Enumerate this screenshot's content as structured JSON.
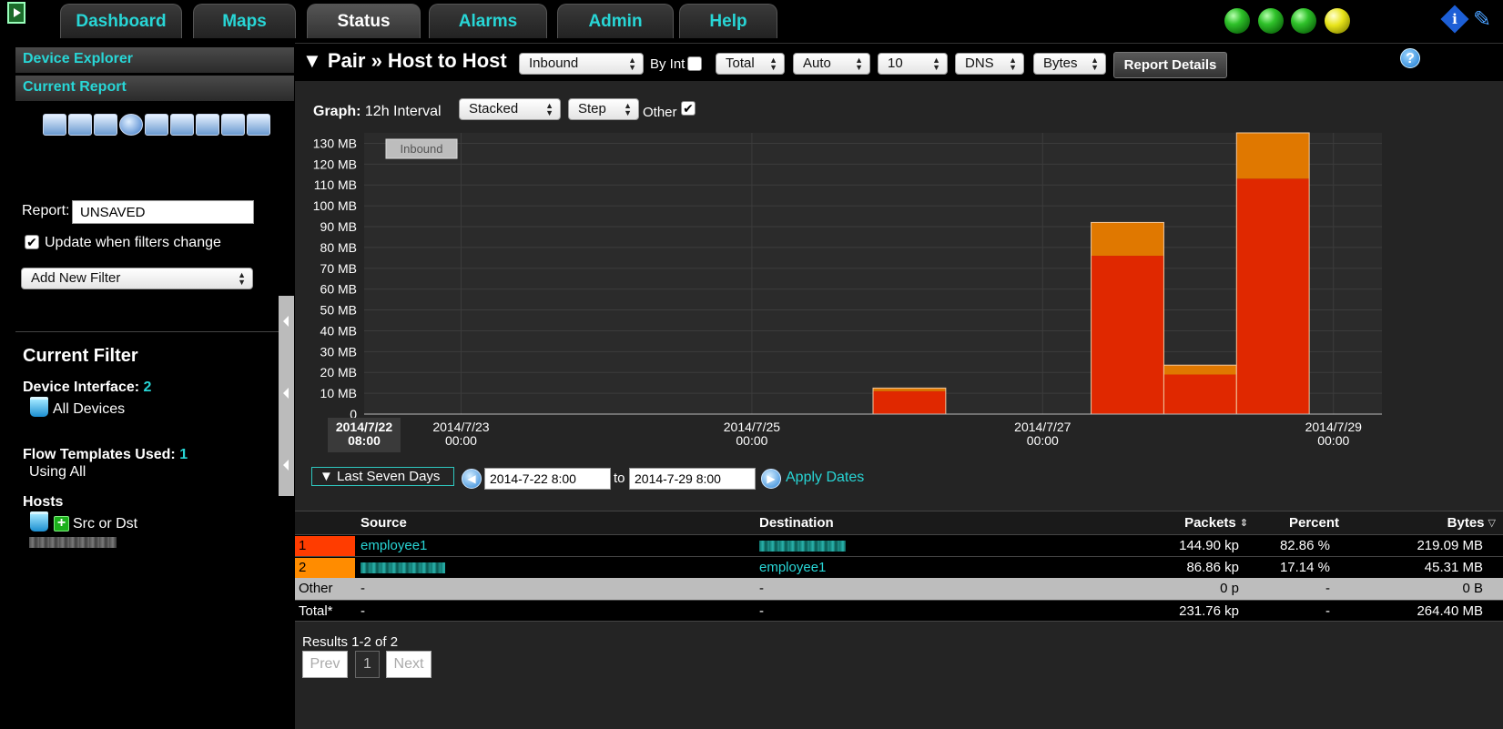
{
  "nav": {
    "tabs": [
      {
        "label": "Dashboard",
        "active": false
      },
      {
        "label": "Maps",
        "active": false
      },
      {
        "label": "Status",
        "active": true
      },
      {
        "label": "Alarms",
        "active": false
      },
      {
        "label": "Admin",
        "active": false
      },
      {
        "label": "Help",
        "active": false
      }
    ],
    "status_leds": [
      "green",
      "green",
      "green",
      "yellow"
    ],
    "icons": [
      "info-icon",
      "tools-icon"
    ]
  },
  "sidebar": {
    "device_explorer": "Device Explorer",
    "current_report": "Current Report",
    "toolbar_icons": [
      "edit-icon",
      "save-icon",
      "save-as-icon",
      "schedule-icon",
      "print-icon",
      "export-icon",
      "email-icon",
      "fax-icon",
      "pdf-icon"
    ],
    "report_label": "Report:",
    "report_value": "UNSAVED",
    "update_label": "Update when filters change",
    "update_checked": true,
    "add_filter": "Add New Filter",
    "current_filter_title": "Current Filter",
    "device_interface_label": "Device Interface:",
    "device_interface_count": "2",
    "all_devices": "All Devices",
    "flow_templates_label": "Flow Templates Used:",
    "flow_templates_count": "1",
    "using_all": "Using All",
    "hosts_label": "Hosts",
    "src_or_dst": "Src or Dst"
  },
  "report": {
    "title": "▼ Pair » Host to Host",
    "direction": "Inbound",
    "by_int_label": "By Int",
    "total": "Total",
    "auto": "Auto",
    "count": "10",
    "dns": "DNS",
    "unit": "Bytes",
    "report_details": "Report Details",
    "help": "?",
    "graph_label": "Graph:",
    "graph_interval": "12h Interval",
    "graph_mode": "Stacked",
    "graph_style": "Step",
    "other_label": "Other",
    "other_checked": true
  },
  "chart_data": {
    "type": "area",
    "stacked": true,
    "step": true,
    "legend_label": "Inbound",
    "y_ticks": [
      "0",
      "10 MB",
      "20 MB",
      "30 MB",
      "40 MB",
      "50 MB",
      "60 MB",
      "70 MB",
      "80 MB",
      "90 MB",
      "100 MB",
      "110 MB",
      "120 MB",
      "130 MB"
    ],
    "ylim": [
      0,
      135
    ],
    "x_tick_labels": [
      {
        "date": "2014/7/22",
        "time": "08:00",
        "highlight": true
      },
      {
        "date": "2014/7/23",
        "time": "00:00"
      },
      {
        "date": "2014/7/25",
        "time": "00:00"
      },
      {
        "date": "2014/7/27",
        "time": "00:00"
      },
      {
        "date": "2014/7/29",
        "time": "00:00"
      }
    ],
    "x_tick_hours": [
      0,
      16,
      64,
      112,
      160
    ],
    "interval_start_hours": [
      0,
      12,
      24,
      36,
      48,
      60,
      72,
      84,
      96,
      108,
      120,
      132,
      144,
      156
    ],
    "series": [
      {
        "name": "employee1",
        "color": "#e02800",
        "values": [
          0,
          0,
          0,
          0,
          0,
          0,
          0,
          11,
          0,
          0,
          76,
          19,
          113,
          0
        ]
      },
      {
        "name": "2",
        "color": "#e07800",
        "values": [
          0,
          0,
          0,
          0,
          0,
          0,
          0,
          1.5,
          0,
          0,
          16,
          4.5,
          29,
          0
        ]
      }
    ]
  },
  "dates": {
    "preset": "▼ Last Seven Days",
    "from": "2014-7-22 8:00",
    "to_label": "to",
    "to": "2014-7-29 8:00",
    "apply": "Apply Dates"
  },
  "table": {
    "headers": {
      "source": "Source",
      "destination": "Destination",
      "packets": "Packets",
      "percent": "Percent",
      "bytes": "Bytes"
    },
    "rows": [
      {
        "rank": "1",
        "color": "#ff3c00",
        "source": "employee1",
        "destination": "",
        "packets": "144.90 kp",
        "percent": "82.86 %",
        "bytes": "219.09 MB"
      },
      {
        "rank": "2",
        "color": "#ff8c00",
        "source": "",
        "destination": "employee1",
        "packets": "86.86 kp",
        "percent": "17.14 %",
        "bytes": "45.31 MB"
      }
    ],
    "other": {
      "label": "Other",
      "source": "-",
      "destination": "-",
      "packets": "0 p",
      "percent": "-",
      "bytes": "0 B"
    },
    "total": {
      "label": "Total*",
      "source": "-",
      "destination": "-",
      "packets": "231.76 kp",
      "percent": "-",
      "bytes": "264.40 MB"
    }
  },
  "pagination": {
    "results": "Results 1-2 of 2",
    "prev": "Prev",
    "page": "1",
    "next": "Next"
  }
}
